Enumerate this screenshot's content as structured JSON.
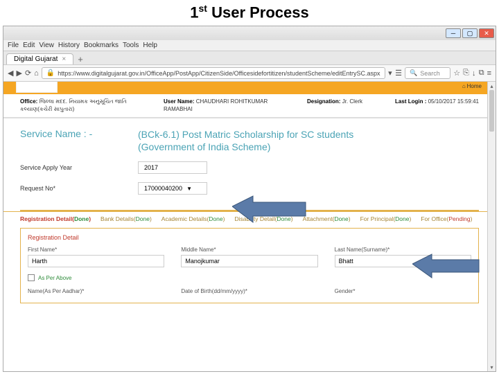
{
  "slide": {
    "title_prefix": "1",
    "title_super": "st",
    "title_rest": " User Process"
  },
  "menubar": [
    "File",
    "Edit",
    "View",
    "History",
    "Bookmarks",
    "Tools",
    "Help"
  ],
  "tab": {
    "title": "Digital Gujarat",
    "add": "+"
  },
  "addressbar": {
    "url": "https://www.digitalgujarat.gov.in/OfficeApp/PostApp/CitizenSide/Officesidefortitizen/studentScheme/editEntrySC.aspx",
    "search_placeholder": "Search"
  },
  "orange": {
    "home": "Home"
  },
  "info": {
    "office_label": "Office:",
    "office_value": "જિલ્લા મદદ. નિયામક અનુસૂચિત જાતિ કલ્યાણ(કચેરી સાપુતારા)",
    "user_label": "User Name:",
    "user_value": "CHAUDHARI ROHITKUMAR RAMABHAI",
    "designation_label": "Designation:",
    "designation_value": "Jr. Clerk",
    "login_label": "Last Login :",
    "login_value": "05/10/2017 15:59:41"
  },
  "service": {
    "label": "Service Name : -",
    "value_line1": "(BCk-6.1) Post Matric Scholarship for SC students",
    "value_line2": "(Government of India Scheme)"
  },
  "form": {
    "year_label": "Service Apply Year",
    "year_value": "2017",
    "request_label": "Request No*",
    "request_value": "17000040200"
  },
  "subtabs": [
    {
      "label": "Registration Detail",
      "status": "Done",
      "active": true
    },
    {
      "label": "Bank Details",
      "status": "Done"
    },
    {
      "label": "Academic Details",
      "status": "Done"
    },
    {
      "label": "Disability Detail",
      "status": "Done"
    },
    {
      "label": "Attachment",
      "status": "Done"
    },
    {
      "label": "For Principal",
      "status": "Done"
    },
    {
      "label": "For Office",
      "status": "Pending"
    }
  ],
  "section": {
    "title": "Registration Detail"
  },
  "names": {
    "first_label": "First Name*",
    "first_value": "Harth",
    "middle_label": "Middle Name*",
    "middle_value": "Manojkumar",
    "last_label": "Last Name(Surname)*",
    "last_value": "Bhatt"
  },
  "checkbox": {
    "label": "As Per Above"
  },
  "bottom": {
    "c1": "Name(As Per Aadhar)*",
    "c2": "Date of Birth(dd/mm/yyyy)*",
    "c3": "Gender*"
  }
}
